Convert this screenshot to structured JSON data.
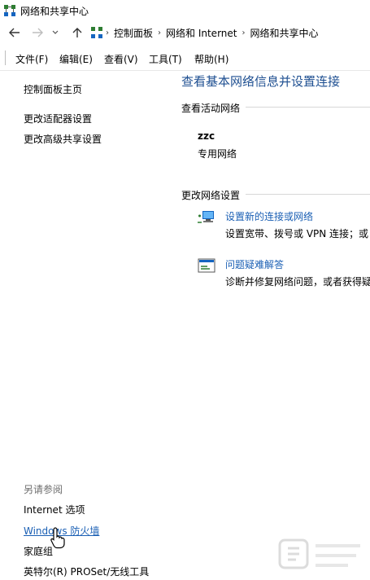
{
  "window": {
    "title": "网络和共享中心"
  },
  "address": {
    "crumbs": [
      "控制面板",
      "网络和 Internet",
      "网络和共享中心"
    ]
  },
  "menu": {
    "items": [
      "文件(F)",
      "编辑(E)",
      "查看(V)",
      "工具(T)",
      "帮助(H)"
    ]
  },
  "sidebar": {
    "links": [
      "控制面板主页",
      "更改适配器设置",
      "更改高级共享设置"
    ],
    "see_also_heading": "另请参阅",
    "see_also": [
      "Internet 选项",
      "Windows 防火墙",
      "家庭组",
      "英特尔(R) PROSet/无线工具"
    ]
  },
  "main": {
    "title": "查看基本网络信息并设置连接",
    "active_heading": "查看活动网络",
    "network": {
      "name": "zzc",
      "type": "专用网络"
    },
    "change_heading": "更改网络设置",
    "tasks": [
      {
        "link": "设置新的连接或网络",
        "desc": "设置宽带、拨号或 VPN 连接；或"
      },
      {
        "link": "问题疑难解答",
        "desc": "诊断并修复网络问题，或者获得疑"
      }
    ]
  },
  "colors": {
    "link": "#1a5fb4",
    "title": "#1e4f91"
  }
}
